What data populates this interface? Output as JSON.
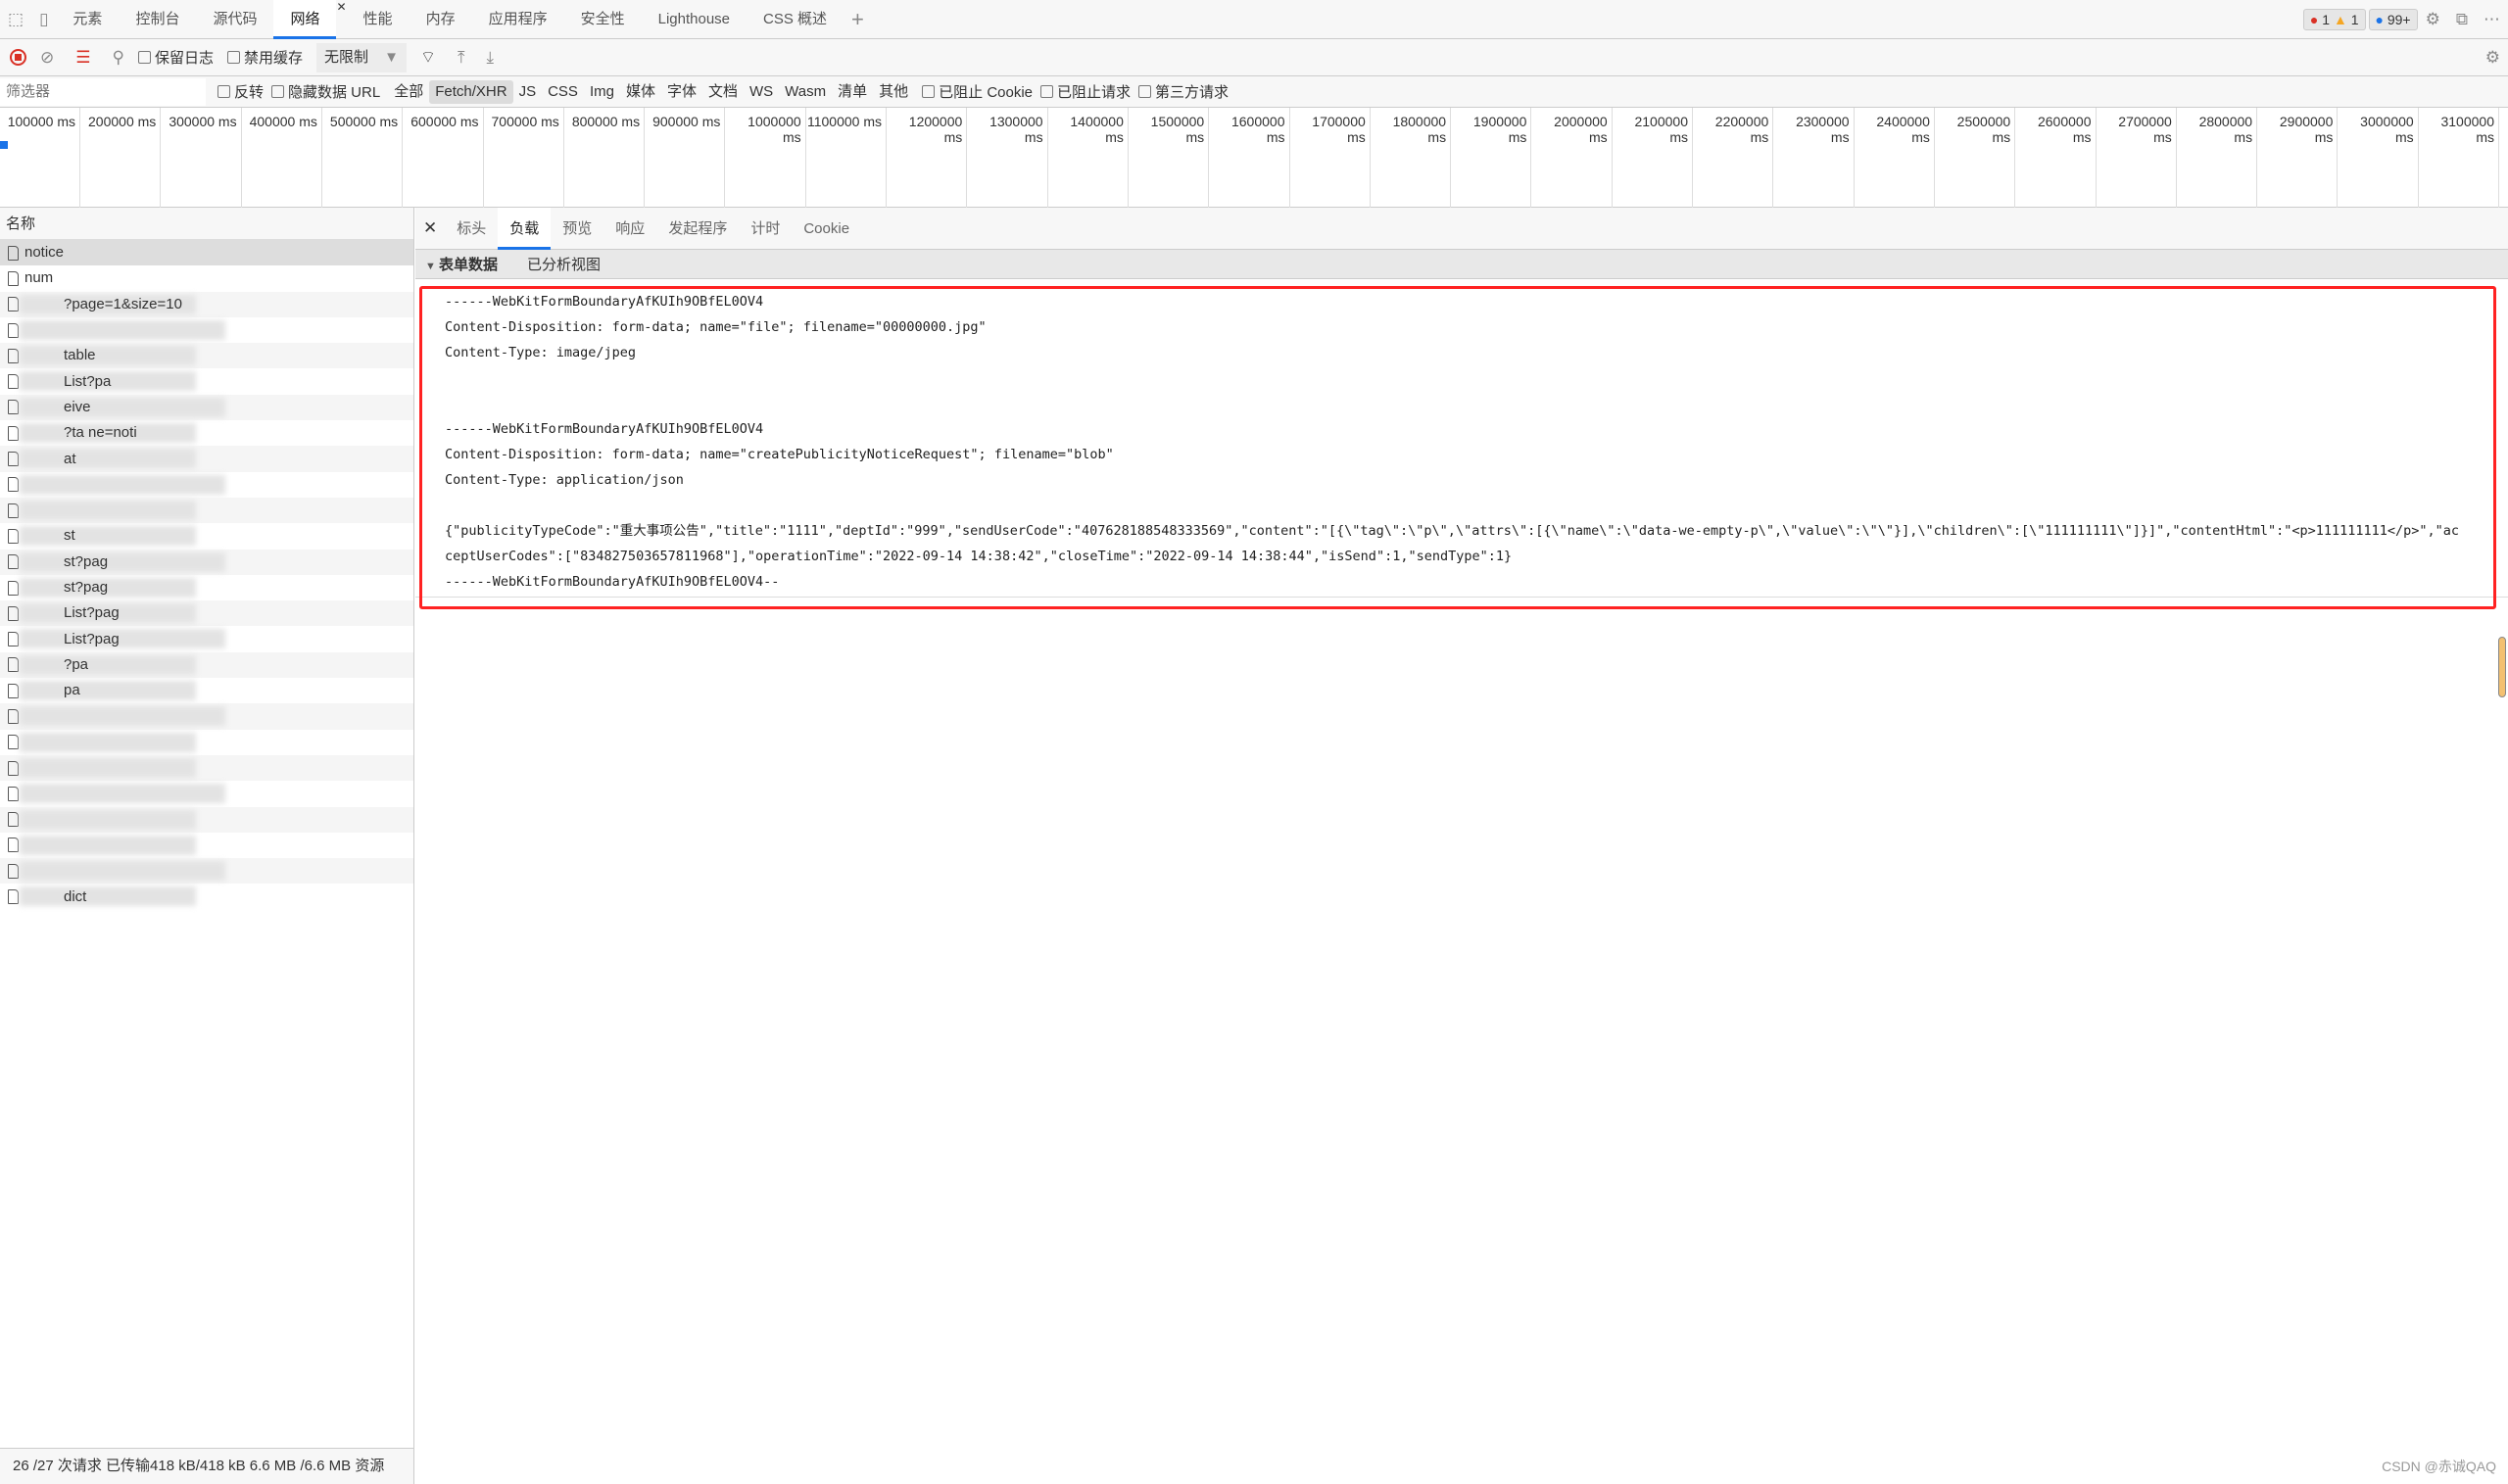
{
  "top_tabs": [
    "元素",
    "控制台",
    "源代码",
    "网络",
    "性能",
    "内存",
    "应用程序",
    "安全性",
    "Lighthouse",
    "CSS 概述"
  ],
  "active_tab": "网络",
  "badges": {
    "errors": "1",
    "warnings": "1",
    "messages": "99+"
  },
  "toolbar": {
    "preserve_log": "保留日志",
    "disable_cache": "禁用缓存",
    "throttle": "无限制"
  },
  "filter": {
    "placeholder": "筛选器",
    "invert": "反转",
    "hide_data_url": "隐藏数据 URL",
    "types": [
      "全部",
      "Fetch/XHR",
      "JS",
      "CSS",
      "Img",
      "媒体",
      "字体",
      "文档",
      "WS",
      "Wasm",
      "清单",
      "其他"
    ],
    "active_type": "Fetch/XHR",
    "blocked_cookies": "已阻止 Cookie",
    "blocked_requests": "已阻止请求",
    "third_party": "第三方请求"
  },
  "timeline": [
    "100000 ms",
    "200000 ms",
    "300000 ms",
    "400000 ms",
    "500000 ms",
    "600000 ms",
    "700000 ms",
    "800000 ms",
    "900000 ms",
    "1000000 ms",
    "1100000 ms",
    "1200000 ms",
    "1300000 ms",
    "1400000 ms",
    "1500000 ms",
    "1600000 ms",
    "1700000 ms",
    "1800000 ms",
    "1900000 ms",
    "2000000 ms",
    "2100000 ms",
    "2200000 ms",
    "2300000 ms",
    "2400000 ms",
    "2500000 ms",
    "2600000 ms",
    "2700000 ms",
    "2800000 ms",
    "2900000 ms",
    "3000000 ms",
    "3100000 ms"
  ],
  "list": {
    "header": "名称",
    "rows": [
      "notice",
      "num",
      "?page=1&size=10",
      "",
      "table",
      "List?pa",
      "eive",
      "?ta    ne=noti",
      "at",
      "",
      "",
      "st",
      "st?pag",
      "st?pag",
      "List?pag",
      "List?pag",
      "?pa",
      "pa",
      "",
      "",
      "",
      "",
      "",
      "",
      "",
      "dict"
    ]
  },
  "detail_tabs": [
    "标头",
    "负载",
    "预览",
    "响应",
    "发起程序",
    "计时",
    "Cookie"
  ],
  "active_detail_tab": "负载",
  "form": {
    "section": "表单数据",
    "parsed_view": "已分析视图"
  },
  "payload_lines": [
    "------WebKitFormBoundaryAfKUIh9OBfEL0OV4",
    "Content-Disposition: form-data; name=\"file\"; filename=\"00000000.jpg\"",
    "Content-Type: image/jpeg",
    "",
    "",
    "------WebKitFormBoundaryAfKUIh9OBfEL0OV4",
    "Content-Disposition: form-data; name=\"createPublicityNoticeRequest\"; filename=\"blob\"",
    "Content-Type: application/json",
    "",
    "{\"publicityTypeCode\":\"重大事项公告\",\"title\":\"1111\",\"deptId\":\"999\",\"sendUserCode\":\"407628188548333569\",\"content\":\"[{\\\"tag\\\":\\\"p\\\",\\\"attrs\\\":[{\\\"name\\\":\\\"data-we-empty-p\\\",\\\"value\\\":\\\"\\\"}],\\\"children\\\":[\\\"111111111\\\"]}]\",\"contentHtml\":\"<p>111111111</p>\",\"ac",
    "ceptUserCodes\":[\"834827503657811968\"],\"operationTime\":\"2022-09-14 14:38:42\",\"closeTime\":\"2022-09-14 14:38:44\",\"isSend\":1,\"sendType\":1}",
    "------WebKitFormBoundaryAfKUIh9OBfEL0OV4--"
  ],
  "status": "26 /27 次请求  已传输418 kB/418 kB  6.6 MB /6.6 MB 资源",
  "watermark": "CSDN @赤诚QAQ",
  "colors": {
    "accent": "#1a73e8",
    "highlight_box": "#ff2222",
    "record": "#d93025"
  }
}
